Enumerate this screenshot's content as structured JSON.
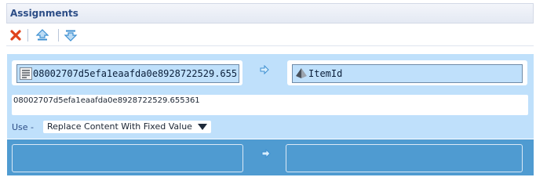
{
  "header": {
    "title": "Assignments"
  },
  "toolbar": {
    "delete_icon": "red-x-icon",
    "move_up_icon": "move-up-arrow-icon",
    "move_down_icon": "move-down-arrow-icon"
  },
  "assignments": [
    {
      "source": {
        "text": "08002707d5efa1eaafda0e8928722529.655",
        "icon": "text-document-icon"
      },
      "target": {
        "text": "ItemId",
        "icon": "pyramid-field-icon"
      },
      "value": "08002707d5efa1eaafda0e8928722529.655361",
      "use_label": "Use -",
      "use_option": "Replace Content With Fixed Value",
      "arrow_icon": "right-arrow-icon"
    },
    {
      "source": {
        "text": ""
      },
      "target": {
        "text": ""
      },
      "arrow_icon": "right-arrow-icon"
    }
  ],
  "colors": {
    "header_title": "#2c4d86",
    "row_selected": "#bfe0fb",
    "row_active": "#4f9bd1",
    "delete": "#e0431b",
    "arrow": "#3d8fd1"
  }
}
